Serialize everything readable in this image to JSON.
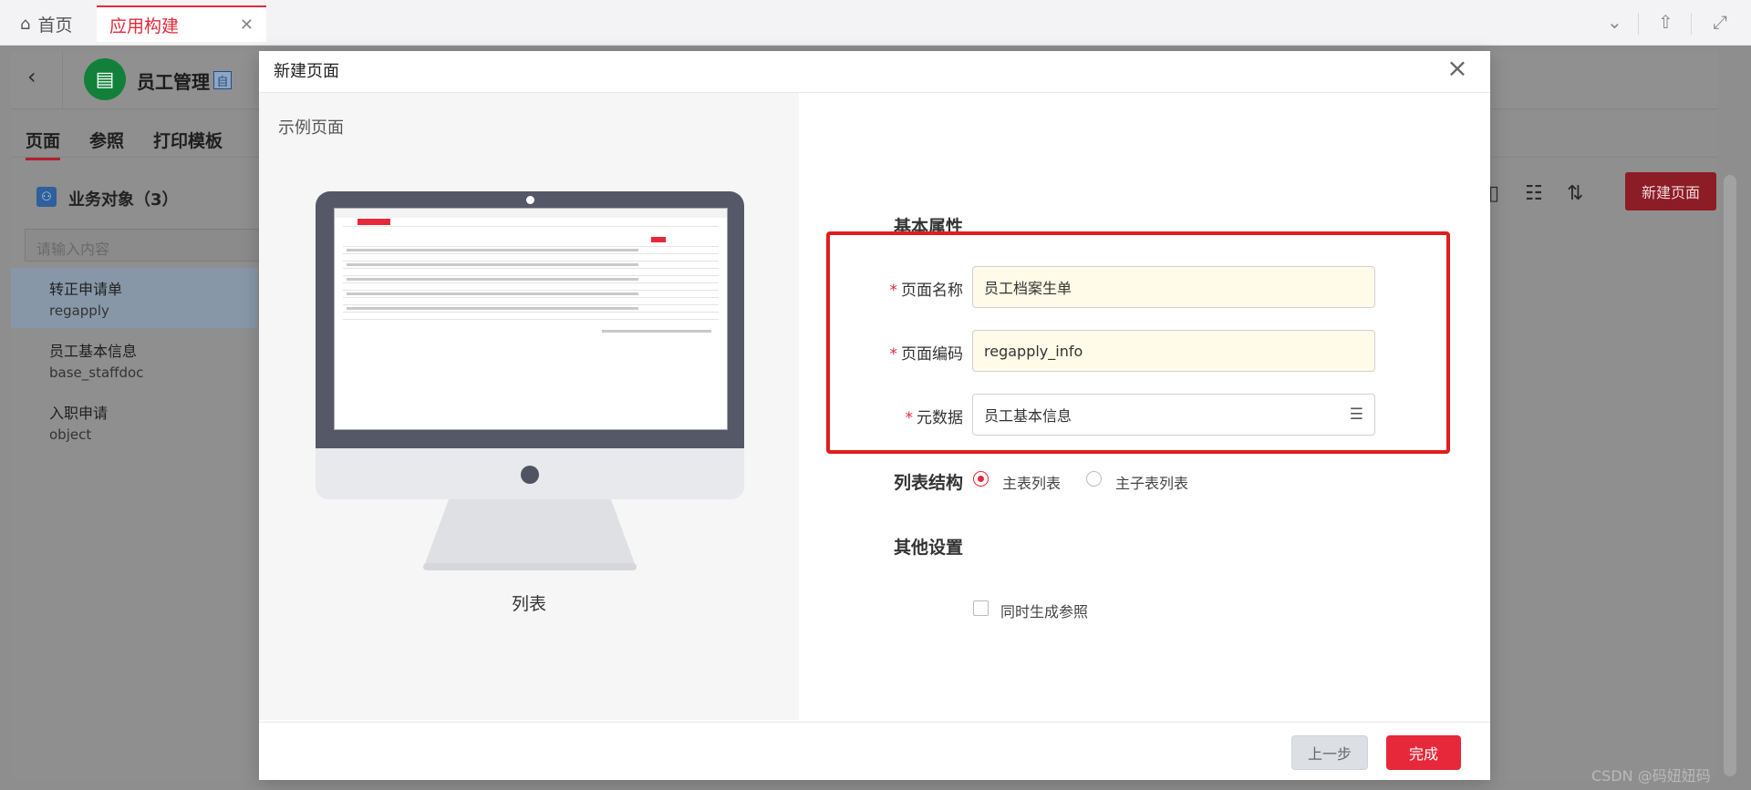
{
  "tabs": {
    "home_label": "首页",
    "app_label": "应用构建"
  },
  "app": {
    "title": "员工管理",
    "badge": "自"
  },
  "nav": {
    "tabs": [
      "页面",
      "参照",
      "打印模板"
    ]
  },
  "sidebar": {
    "title": "业务对象（3）",
    "search_placeholder": "请输入内容",
    "items": [
      {
        "name": "转正申请单",
        "code": "regapply"
      },
      {
        "name": "员工基本信息",
        "code": "base_staffdoc"
      },
      {
        "name": "入职申请",
        "code": "object"
      }
    ]
  },
  "toolbar": {
    "new_page_label": "新建页面"
  },
  "modal": {
    "title": "新建页面",
    "sample_label": "示例页面",
    "preview_caption": "列表",
    "basic_section": "基本属性",
    "fields": [
      {
        "label": "页面名称",
        "value": "员工档案生单"
      },
      {
        "label": "页面编码",
        "value": "regapply_info"
      },
      {
        "label": "元数据",
        "value": "员工基本信息"
      }
    ],
    "list_structure_label": "列表结构",
    "list_options": [
      "主表列表",
      "主子表列表"
    ],
    "other_section": "其他设置",
    "checkbox_label": "同时生成参照",
    "prev_label": "上一步",
    "done_label": "完成"
  },
  "colors": {
    "accent": "#e6283a",
    "highlight_box": "#e01d1d"
  },
  "watermark": "CSDN @码妞妞码"
}
